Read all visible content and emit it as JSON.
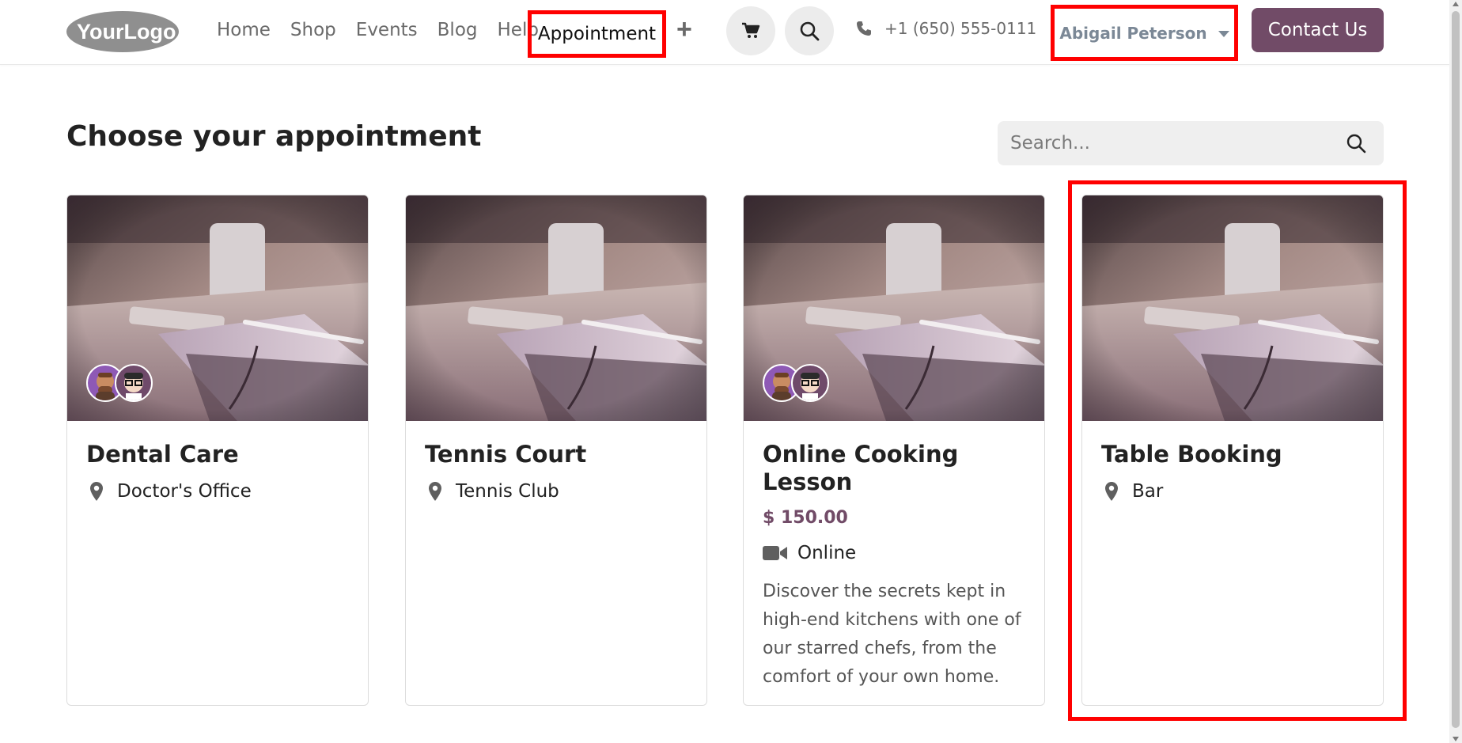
{
  "header": {
    "logo_text": "YourLogo",
    "nav": [
      {
        "label": "Home",
        "active": false
      },
      {
        "label": "Shop",
        "active": false
      },
      {
        "label": "Events",
        "active": false
      },
      {
        "label": "Blog",
        "active": false
      },
      {
        "label": "Help",
        "active": false
      }
    ],
    "nav_active": {
      "label": "Appointment"
    },
    "add_icon": "plus-icon",
    "cart_icon": "cart-icon",
    "search_icon": "search-icon",
    "phone": {
      "icon": "phone-icon",
      "number": "+1 (650) 555-0111"
    },
    "user": {
      "name": "Abigail Peterson",
      "icon": "caret-down-icon"
    },
    "contact_label": "Contact Us"
  },
  "page": {
    "title": "Choose your appointment",
    "search": {
      "placeholder": "Search...",
      "value": ""
    }
  },
  "cards": [
    {
      "title": "Dental Care",
      "location": "Doctor's Office",
      "has_avatars": true
    },
    {
      "title": "Tennis Court",
      "location": "Tennis Club",
      "has_avatars": false
    },
    {
      "title": "Online Cooking Lesson",
      "price": "$ 150.00",
      "mode": "Online",
      "description": "Discover the secrets kept in high-end kitchens with one of our starred chefs, from the comfort of your own home.",
      "has_avatars": true
    },
    {
      "title": "Table Booking",
      "location": "Bar",
      "has_avatars": false
    }
  ],
  "colors": {
    "brand": "#714b67",
    "highlight": "#ff0000",
    "nav_text": "#6a6a6a",
    "user_text": "#7b8896"
  }
}
